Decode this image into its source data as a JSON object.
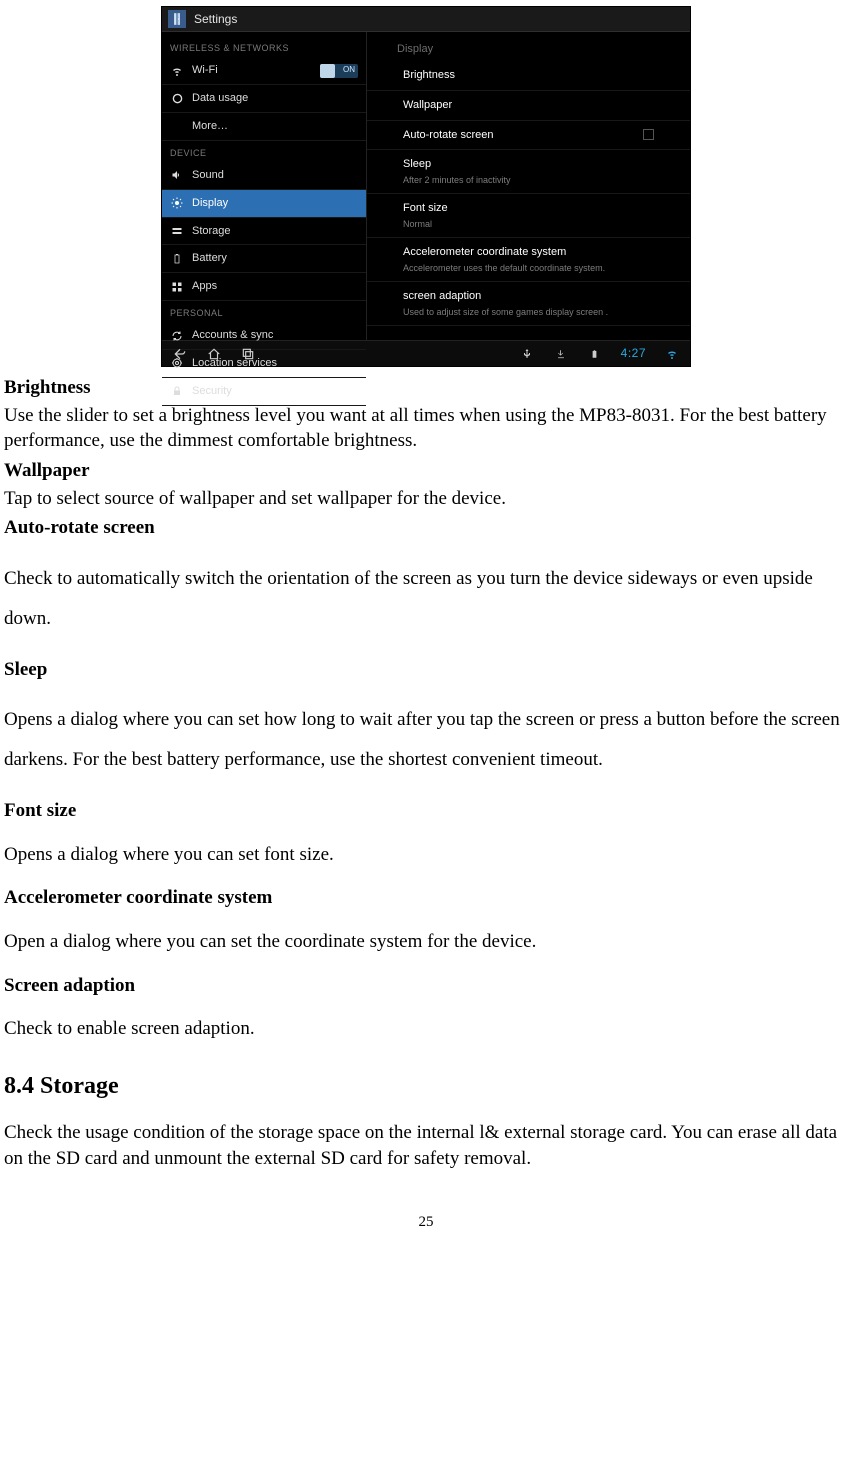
{
  "screenshot": {
    "title": "Settings",
    "sidebar": {
      "section1": "WIRELESS & NETWORKS",
      "wifi": "Wi-Fi",
      "wifi_toggle": "ON",
      "datausage": "Data usage",
      "more": "More…",
      "section2": "DEVICE",
      "sound": "Sound",
      "display": "Display",
      "storage": "Storage",
      "battery": "Battery",
      "apps": "Apps",
      "section3": "PERSONAL",
      "accounts": "Accounts & sync",
      "location": "Location services",
      "security": "Security"
    },
    "detail": {
      "header": "Display",
      "brightness": "Brightness",
      "wallpaper": "Wallpaper",
      "autorotate": "Auto-rotate screen",
      "sleep": "Sleep",
      "sleep_sub": "After 2 minutes of inactivity",
      "fontsize": "Font size",
      "fontsize_sub": "Normal",
      "accel": "Accelerometer coordinate system",
      "accel_sub": "Accelerometer uses the default coordinate system.",
      "adaption": "screen adaption",
      "adaption_sub": "Used to adjust size of some games display screen ."
    },
    "clock": "4:27"
  },
  "doc": {
    "h_brightness": "Brightness",
    "p_brightness": "Use the slider to set a brightness level you want at all times when using the MP83-8031. For the best battery performance, use the dimmest comfortable brightness.",
    "h_wallpaper": "Wallpaper",
    "p_wallpaper": "Tap to select source of wallpaper and set wallpaper for the device.",
    "h_autorotate": "Auto-rotate screen",
    "p_autorotate": "Check to automatically switch the orientation of the screen as you turn the device sideways or even upside down.",
    "h_sleep": "Sleep",
    "p_sleep": "Opens a dialog where you can set how long to wait after you tap the screen or press a button before the screen darkens. For the best battery performance, use the shortest convenient timeout.",
    "h_fontsize": "Font size",
    "p_fontsize": "Opens a dialog where you can set font size.",
    "h_accel": "Accelerometer coordinate system",
    "p_accel": "Open a dialog where you can set the coordinate system for the device.",
    "h_adaption": "Screen adaption",
    "p_adaption": "Check to enable screen adaption.",
    "h_storage": "8.4 Storage",
    "p_storage": "Check the usage condition of the storage space on the internal l& external storage card. You can erase all data on the SD card and unmount the external SD card for safety removal.",
    "page_num": "25"
  }
}
